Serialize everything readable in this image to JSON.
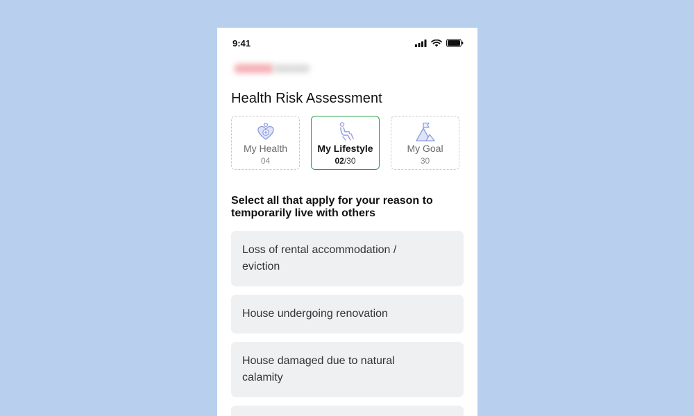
{
  "status_bar": {
    "time": "9:41",
    "icons": [
      "signal-icon",
      "wifi-icon",
      "battery-icon"
    ]
  },
  "brand": {
    "logo": "blurred-brand-logo"
  },
  "page": {
    "title": "Health Risk Assessment"
  },
  "tabs": [
    {
      "label": "My Health",
      "count": "04",
      "icon": "heart-plus-icon",
      "active": false
    },
    {
      "label": "My Lifestyle",
      "count_current": "02",
      "count_total": "/30",
      "icon": "person-seated-icon",
      "active": true
    },
    {
      "label": "My Goal",
      "count": "30",
      "icon": "mountain-flag-icon",
      "active": false
    }
  ],
  "question": "Select all that apply for your reason to temporarily live with others",
  "options": [
    {
      "label": "Loss of rental accommodation / eviction"
    },
    {
      "label": "House undergoing renovation"
    },
    {
      "label": "House damaged due to natural calamity"
    },
    {
      "label": ""
    }
  ],
  "colors": {
    "background": "#b8d0ee",
    "active_tab_border": "#27a044",
    "option_bg": "#eff0f2",
    "icon_tint": "#8d9be0"
  }
}
